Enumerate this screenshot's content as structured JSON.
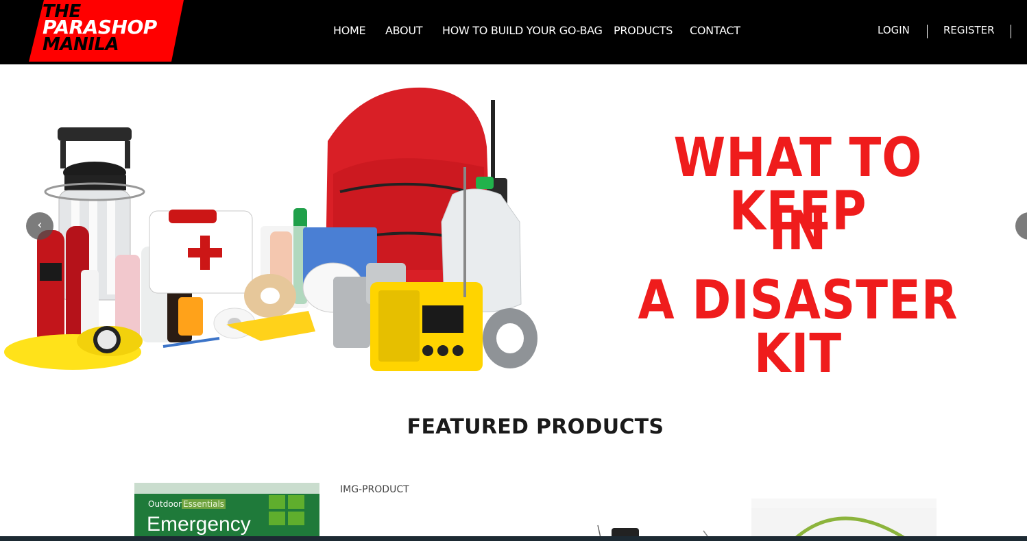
{
  "brand": {
    "logo_line1": "THE",
    "logo_line2": "PARASHOP",
    "logo_line3": "MANILA",
    "logo_color": "#ff0000"
  },
  "nav": {
    "home": "HOME",
    "about": "ABOUT",
    "howto": "HOW TO BUILD YOUR GO-BAG",
    "products": "PRODUCTS",
    "contact": "CONTACT"
  },
  "account": {
    "login": "LOGIN",
    "register": "REGISTER"
  },
  "hero": {
    "line1": "WHAT TO KEEP",
    "line2": "IN",
    "line3": "A DISASTER KIT",
    "prev_icon": "‹",
    "text_color": "#ef1c1c"
  },
  "featured": {
    "title": "FEATURED PRODUCTS",
    "products": [
      {
        "brand_a": "Outdoor",
        "brand_b": "Essentials",
        "name": "Emergency"
      },
      {
        "alt": "IMG-PRODUCT"
      }
    ]
  }
}
